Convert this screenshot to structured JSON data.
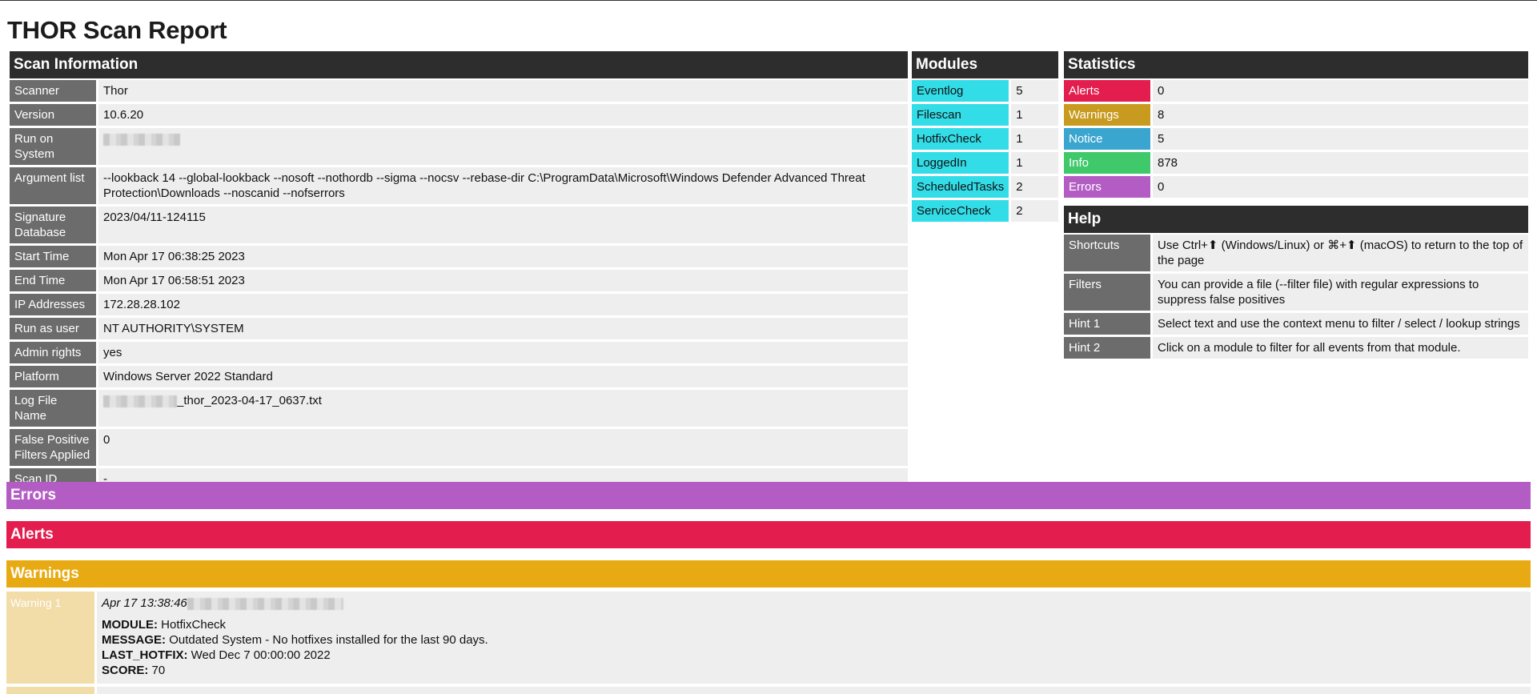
{
  "page": {
    "title": "THOR Scan Report"
  },
  "scan_info": {
    "header": "Scan Information",
    "rows": [
      {
        "key": "Scanner",
        "value": "Thor"
      },
      {
        "key": "Version",
        "value": "10.6.20"
      },
      {
        "key": "Run on System",
        "value": ""
      },
      {
        "key": "Argument list",
        "value": "--lookback 14 --global-lookback --nosoft --nothordb --sigma --nocsv --rebase-dir C:\\ProgramData\\Microsoft\\Windows Defender Advanced Threat Protection\\Downloads --noscanid --nofserrors"
      },
      {
        "key": "Signature Database",
        "value": "2023/04/11-124115"
      },
      {
        "key": "Start Time",
        "value": "Mon Apr 17 06:38:25 2023"
      },
      {
        "key": "End Time",
        "value": "Mon Apr 17 06:58:51 2023"
      },
      {
        "key": "IP Addresses",
        "value": "172.28.28.102"
      },
      {
        "key": "Run as user",
        "value": "NT AUTHORITY\\SYSTEM"
      },
      {
        "key": "Admin rights",
        "value": "yes"
      },
      {
        "key": "Platform",
        "value": "Windows Server 2022 Standard"
      },
      {
        "key": "Log File Name",
        "value": "_thor_2023-04-17_0637.txt"
      },
      {
        "key": "False Positive Filters Applied",
        "value": "0"
      },
      {
        "key": "Scan ID",
        "value": "-"
      }
    ]
  },
  "modules": {
    "header": "Modules",
    "color": "#33dde8",
    "rows": [
      {
        "key": "Eventlog",
        "value": "5"
      },
      {
        "key": "Filescan",
        "value": "1"
      },
      {
        "key": "HotfixCheck",
        "value": "1"
      },
      {
        "key": "LoggedIn",
        "value": "1"
      },
      {
        "key": "ScheduledTasks",
        "value": "2"
      },
      {
        "key": "ServiceCheck",
        "value": "2"
      }
    ]
  },
  "statistics": {
    "header": "Statistics",
    "rows": [
      {
        "key": "Alerts",
        "value": "0",
        "color": "#e31d4e"
      },
      {
        "key": "Warnings",
        "value": "8",
        "color": "#c89a1f"
      },
      {
        "key": "Notice",
        "value": "5",
        "color": "#3aa5cf"
      },
      {
        "key": "Info",
        "value": "878",
        "color": "#3fc96a"
      },
      {
        "key": "Errors",
        "value": "0",
        "color": "#b35dc4"
      }
    ]
  },
  "help": {
    "header": "Help",
    "rows": [
      {
        "key": "Shortcuts",
        "value": "Use Ctrl+⬆ (Windows/Linux) or ⌘+⬆ (macOS) to return to the top of the page"
      },
      {
        "key": "Filters",
        "value": "You can provide a file (--filter file) with regular expressions to suppress false positives"
      },
      {
        "key": "Hint 1",
        "value": "Select text and use the context menu to filter / select / lookup strings"
      },
      {
        "key": "Hint 2",
        "value": "Click on a module to filter for all events from that module."
      }
    ]
  },
  "sections": {
    "errors": {
      "label": "Errors",
      "color": "#b35dc4"
    },
    "alerts": {
      "label": "Alerts",
      "color": "#e31d4e"
    },
    "warnings": {
      "label": "Warnings",
      "color": "#e8aa12"
    }
  },
  "warning_1": {
    "label": "Warning 1",
    "time": "Apr 17 13:38:46",
    "module_key": "MODULE:",
    "module_val": "HotfixCheck",
    "message_key": "MESSAGE:",
    "message_val": "Outdated System - No hotfixes installed for the last 90 days.",
    "last_hotfix_key": "LAST_HOTFIX:",
    "last_hotfix_val": "Wed Dec 7 00:00:00 2022",
    "score_key": "SCORE:",
    "score_val": "70"
  }
}
